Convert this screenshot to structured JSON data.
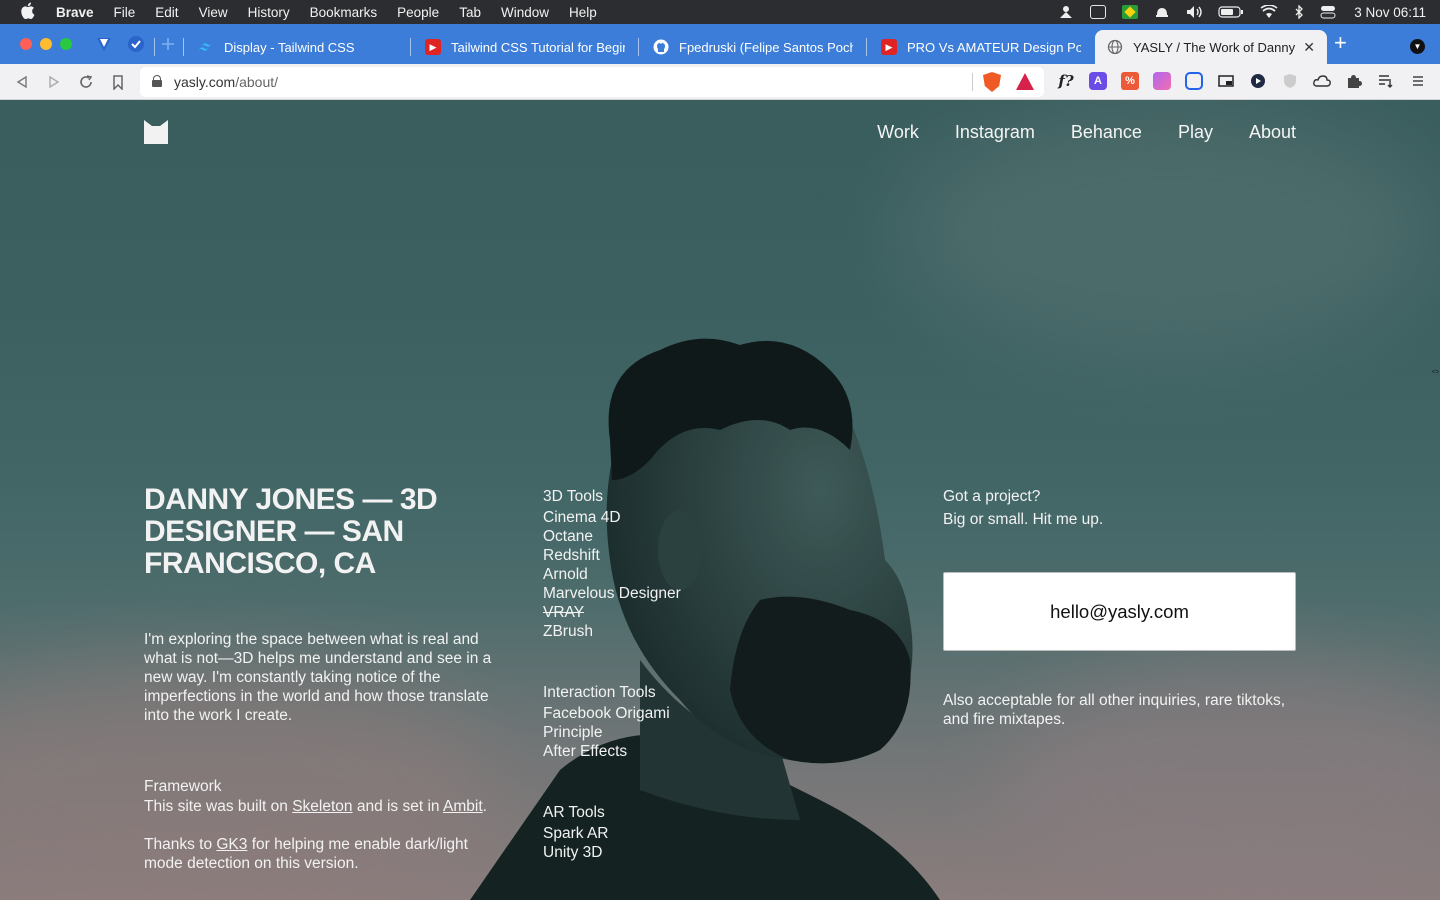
{
  "menubar": {
    "app": "Brave",
    "items": [
      "File",
      "Edit",
      "View",
      "History",
      "Bookmarks",
      "People",
      "Tab",
      "Window",
      "Help"
    ],
    "clock": "3 Nov  06:11"
  },
  "tabs": [
    {
      "title": "Display - Tailwind CSS",
      "favicon": "tailwind-icon",
      "active": false
    },
    {
      "title": "Tailwind CSS Tutorial for Beginner",
      "favicon": "youtube-icon",
      "active": false
    },
    {
      "title": "Fpedruski (Felipe Santos Poch)",
      "favicon": "github-icon",
      "active": false
    },
    {
      "title": "PRO Vs AMATEUR Design Portfolio",
      "favicon": "youtube-icon",
      "active": false
    },
    {
      "title": "YASLY / The Work of Danny Jo",
      "favicon": "globe-icon",
      "active": true
    }
  ],
  "toolbar": {
    "url_host": "yasly.com",
    "url_path": "/about/"
  },
  "site": {
    "nav": [
      "Work",
      "Instagram",
      "Behance",
      "Play",
      "About"
    ],
    "headline": "DANNY JONES — 3D DESIGNER — SAN FRANCISCO, CA",
    "bio": "I'm exploring the space between what is real and what is not—3D helps me understand and see in a new way. I'm constantly taking notice of the imperfections in the world and how those translate into the work I create.",
    "framework": {
      "heading": "Framework",
      "text_before": "This site was built on ",
      "link1": "Skeleton",
      "text_mid": " and is set in ",
      "link2": "Ambit",
      "text_after": "."
    },
    "thanks": {
      "before": "Thanks to ",
      "link": "GK3",
      "after": " for helping me enable dark/light mode detection on this version."
    },
    "tool_groups": [
      {
        "heading": "3D Tools",
        "items": [
          "Cinema 4D",
          "Octane",
          "Redshift",
          "Arnold",
          "Marvelous Designer",
          "VRAY",
          "ZBrush"
        ]
      },
      {
        "heading": "Interaction Tools",
        "items": [
          "Facebook Origami",
          "Principle",
          "After Effects"
        ]
      },
      {
        "heading": "AR Tools",
        "items": [
          "Spark AR",
          "Unity 3D"
        ]
      }
    ],
    "cta": {
      "line1": "Got a project?",
      "line2": "Big or small. Hit me up.",
      "email": "hello@yasly.com",
      "also": "Also acceptable for all other inquiries, rare tiktoks, and fire mixtapes."
    }
  }
}
